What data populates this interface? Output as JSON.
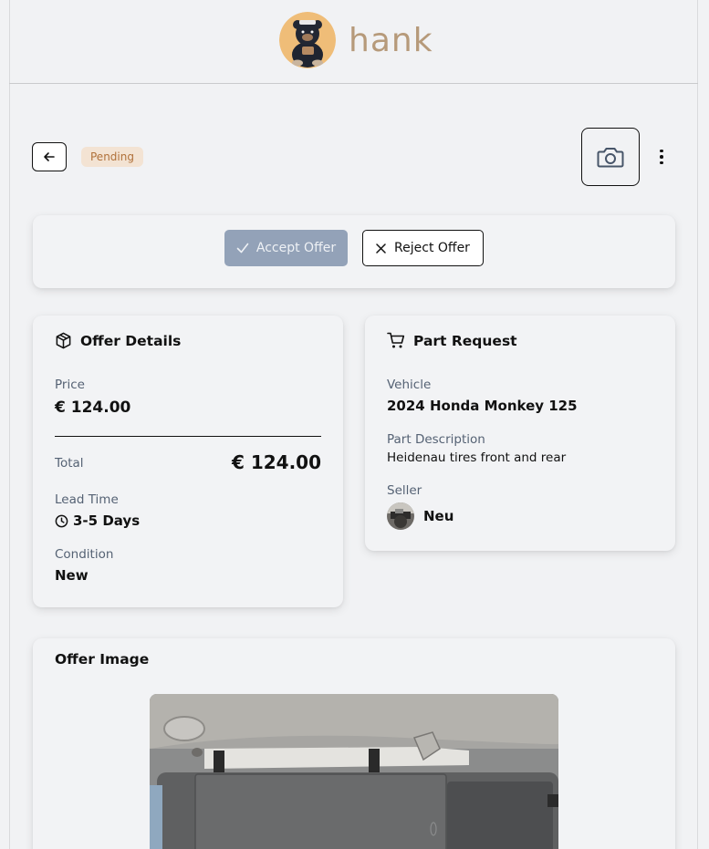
{
  "brand": {
    "name": "hank",
    "logo_icon": "bear-mascot-icon"
  },
  "toolbar": {
    "back_icon": "arrow-left-icon",
    "status": "Pending",
    "camera_icon": "camera-icon",
    "more_icon": "more-vertical-icon"
  },
  "actions": {
    "accept_label": "Accept Offer",
    "reject_label": "Reject Offer"
  },
  "offer_details": {
    "title": "Offer Details",
    "price_label": "Price",
    "price_value": "€ 124.00",
    "total_label": "Total",
    "total_value": "€ 124.00",
    "lead_time_label": "Lead Time",
    "lead_time_value": "3-5 Days",
    "condition_label": "Condition",
    "condition_value": "New"
  },
  "part_request": {
    "title": "Part Request",
    "vehicle_label": "Vehicle",
    "vehicle_value": "2024 Honda Monkey 125",
    "description_label": "Part Description",
    "description_value": "Heidenau tires front and rear",
    "seller_label": "Seller",
    "seller_name": "Neu"
  },
  "offer_image": {
    "title": "Offer Image"
  },
  "colors": {
    "background": "#f1f2f4",
    "accent_disabled": "#93a2b8",
    "pending_bg": "#f3e3d3",
    "pending_text": "#b0713a",
    "brand_text": "#b69a7a"
  }
}
